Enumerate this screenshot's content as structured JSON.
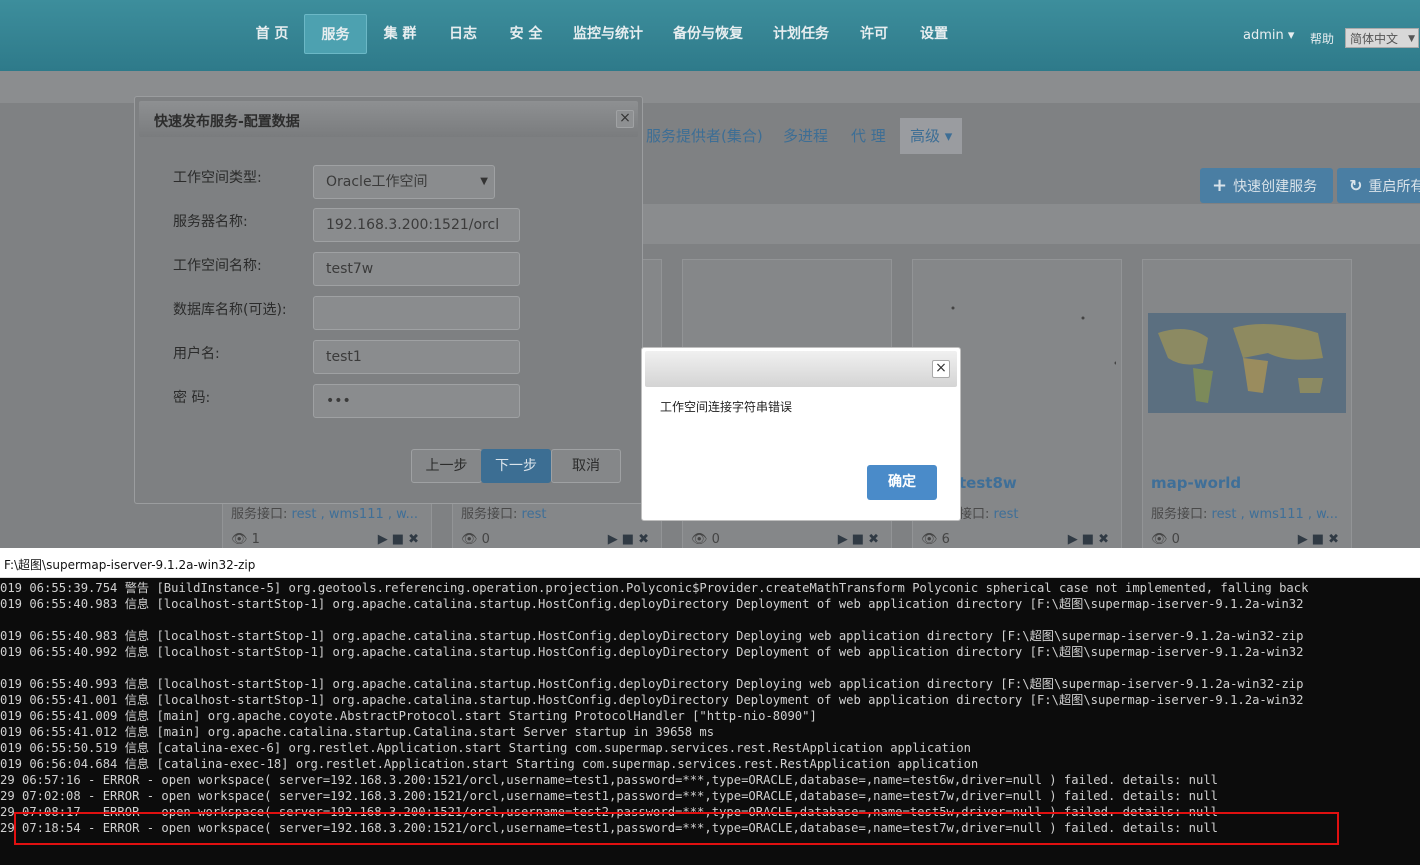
{
  "nav": {
    "items": [
      "首 页",
      "服务",
      "集 群",
      "日志",
      "安 全",
      "监控与统计",
      "备份与恢复",
      "计划任务",
      "许可",
      "设置"
    ],
    "active": "服务",
    "user": "admin ▾",
    "help": "帮助",
    "language": "简体中文"
  },
  "tabs": {
    "providers": "服务提供者(集合)",
    "multiprocess": "多进程",
    "proxy": "代 理",
    "advanced": "高级 ▾"
  },
  "actions": {
    "quick_create": "快速创建服务",
    "restart_all": "重启所有"
  },
  "cards": [
    {
      "iface_label": "服务接口:",
      "iface_value": "rest , wms111 , w...",
      "count": "1"
    },
    {
      "iface_label": "服务接口:",
      "iface_value": "rest",
      "count": "0"
    },
    {
      "iface_label": "",
      "iface_value": "",
      "count": "0"
    },
    {
      "title": "test8w",
      "iface_label": "接口:",
      "iface_value": "rest",
      "count": "6"
    },
    {
      "title": "map-world",
      "iface_label": "服务接口:",
      "iface_value": "rest , wms111 , w...",
      "count": "0"
    }
  ],
  "publish_dialog": {
    "title": "快速发布服务-配置数据",
    "close": "×",
    "fields": {
      "workspace_type_label": "工作空间类型:",
      "workspace_type_value": "Oracle工作空间",
      "server_label": "服务器名称:",
      "server_value": "192.168.3.200:1521/orcl",
      "workspace_name_label": "工作空间名称:",
      "workspace_name_value": "test7w",
      "database_label": "数据库名称(可选):",
      "database_value": "",
      "user_label": "用户名:",
      "user_value": "test1",
      "password_label": "密 码:",
      "password_value": "•••"
    },
    "buttons": {
      "prev": "上一步",
      "next": "下一步",
      "cancel": "取消"
    }
  },
  "error_dialog": {
    "close": "×",
    "message": "工作空间连接字符串错误",
    "ok": "确定"
  },
  "console": {
    "title": "F:\\超图\\supermap-iserver-9.1.2a-win32-zip",
    "lines": [
      "019 06:55:39.754 警告 [BuildInstance-5] org.geotools.referencing.operation.projection.Polyconic$Provider.createMathTransform Polyconic spherical case not implemented, falling back",
      "019 06:55:40.983 信息 [localhost-startStop-1] org.apache.catalina.startup.HostConfig.deployDirectory Deployment of web application directory [F:\\超图\\supermap-iserver-9.1.2a-win32",
      "",
      "019 06:55:40.983 信息 [localhost-startStop-1] org.apache.catalina.startup.HostConfig.deployDirectory Deploying web application directory [F:\\超图\\supermap-iserver-9.1.2a-win32-zip",
      "019 06:55:40.992 信息 [localhost-startStop-1] org.apache.catalina.startup.HostConfig.deployDirectory Deployment of web application directory [F:\\超图\\supermap-iserver-9.1.2a-win32",
      "",
      "019 06:55:40.993 信息 [localhost-startStop-1] org.apache.catalina.startup.HostConfig.deployDirectory Deploying web application directory [F:\\超图\\supermap-iserver-9.1.2a-win32-zip",
      "019 06:55:41.001 信息 [localhost-startStop-1] org.apache.catalina.startup.HostConfig.deployDirectory Deployment of web application directory [F:\\超图\\supermap-iserver-9.1.2a-win32",
      "019 06:55:41.009 信息 [main] org.apache.coyote.AbstractProtocol.start Starting ProtocolHandler [\"http-nio-8090\"]",
      "019 06:55:41.012 信息 [main] org.apache.catalina.startup.Catalina.start Server startup in 39658 ms",
      "019 06:55:50.519 信息 [catalina-exec-6] org.restlet.Application.start Starting com.supermap.services.rest.RestApplication application",
      "019 06:56:04.684 信息 [catalina-exec-18] org.restlet.Application.start Starting com.supermap.services.rest.RestApplication application",
      "29 06:57:16 - ERROR - open workspace( server=192.168.3.200:1521/orcl,username=test1,password=***,type=ORACLE,database=,name=test6w,driver=null ) failed. details: null",
      "29 07:02:08 - ERROR - open workspace( server=192.168.3.200:1521/orcl,username=test1,password=***,type=ORACLE,database=,name=test7w,driver=null ) failed. details: null",
      "29 07:08:17 - ERROR - open workspace( server=192.168.3.200:1521/orcl,username=test2,password=***,type=ORACLE,database=,name=test5w,driver=null ) failed. details: null",
      "29 07:18:54 - ERROR - open workspace( server=192.168.3.200:1521/orcl,username=test1,password=***,type=ORACLE,database=,name=test7w,driver=null ) failed. details: null"
    ]
  },
  "colors": {
    "topbar": "#2e7a8a",
    "link": "#3f6f98",
    "primary_button": "#4a8bc9",
    "highlight": "#e01010",
    "console_bg": "#0c0c0c"
  }
}
